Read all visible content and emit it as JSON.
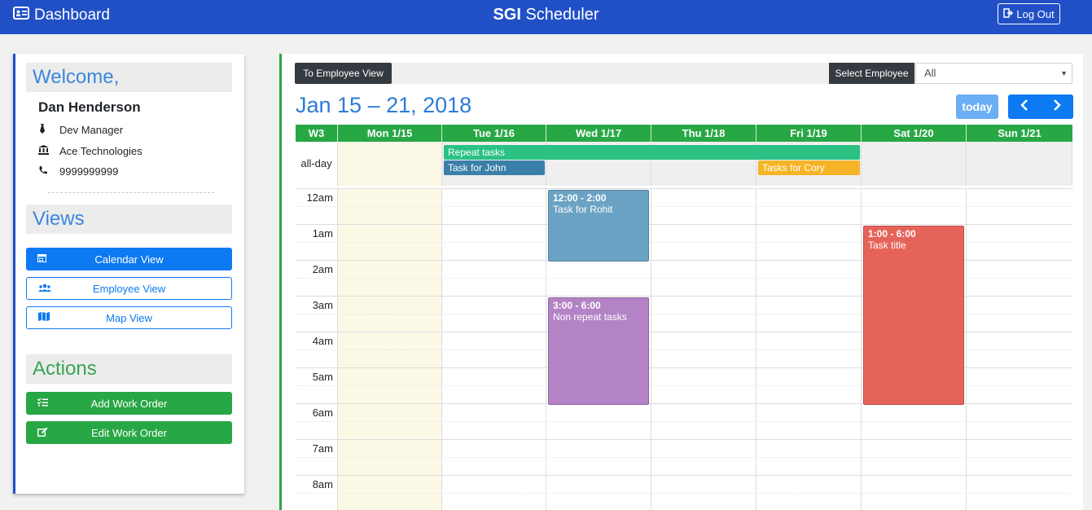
{
  "header": {
    "brand": "Dashboard",
    "app_title_bold": "SGI",
    "app_title_rest": "Scheduler",
    "logout": "Log Out"
  },
  "sidebar": {
    "welcome": "Welcome,",
    "user": {
      "name": "Dan Henderson",
      "role": "Dev Manager",
      "company": "Ace Technologies",
      "phone": "9999999999"
    },
    "views_title": "Views",
    "views": [
      {
        "label": "Calendar View",
        "icon": "calendar-icon"
      },
      {
        "label": "Employee View",
        "icon": "users-icon"
      },
      {
        "label": "Map View",
        "icon": "map-icon"
      }
    ],
    "actions_title": "Actions",
    "actions": [
      {
        "label": "Add Work Order",
        "icon": "checklist-icon"
      },
      {
        "label": "Edit Work Order",
        "icon": "edit-icon"
      }
    ]
  },
  "calendar": {
    "to_employee_view": "To Employee View",
    "select_employee_label": "Select Employee",
    "select_employee_value": "All",
    "title": "Jan 15 – 21, 2018",
    "today_label": "today",
    "week_label": "W3",
    "days": [
      "Mon 1/15",
      "Tue 1/16",
      "Wed 1/17",
      "Thu 1/18",
      "Fri 1/19",
      "Sat 1/20",
      "Sun 1/21"
    ],
    "allday_label": "all-day",
    "hours": [
      "12am",
      "1am",
      "2am",
      "3am",
      "4am",
      "5am",
      "6am",
      "7am",
      "8am"
    ],
    "allday_events": [
      {
        "title": "Repeat tasks",
        "color": "#2ac183"
      },
      {
        "title": "Task for John",
        "color": "#3a7fa8"
      },
      {
        "title": "Tasks for Cory",
        "color": "#f5b427"
      }
    ],
    "timed_events": [
      {
        "time": "12:00 - 2:00",
        "title": "Task for Rohit",
        "color": "#6ba3c4"
      },
      {
        "time": "3:00 - 6:00",
        "title": "Non repeat tasks",
        "color": "#b383c6"
      },
      {
        "time": "1:00 - 6:00",
        "title": "Task title",
        "color": "#e6635a"
      }
    ],
    "today_color": "#fcf8e6"
  }
}
